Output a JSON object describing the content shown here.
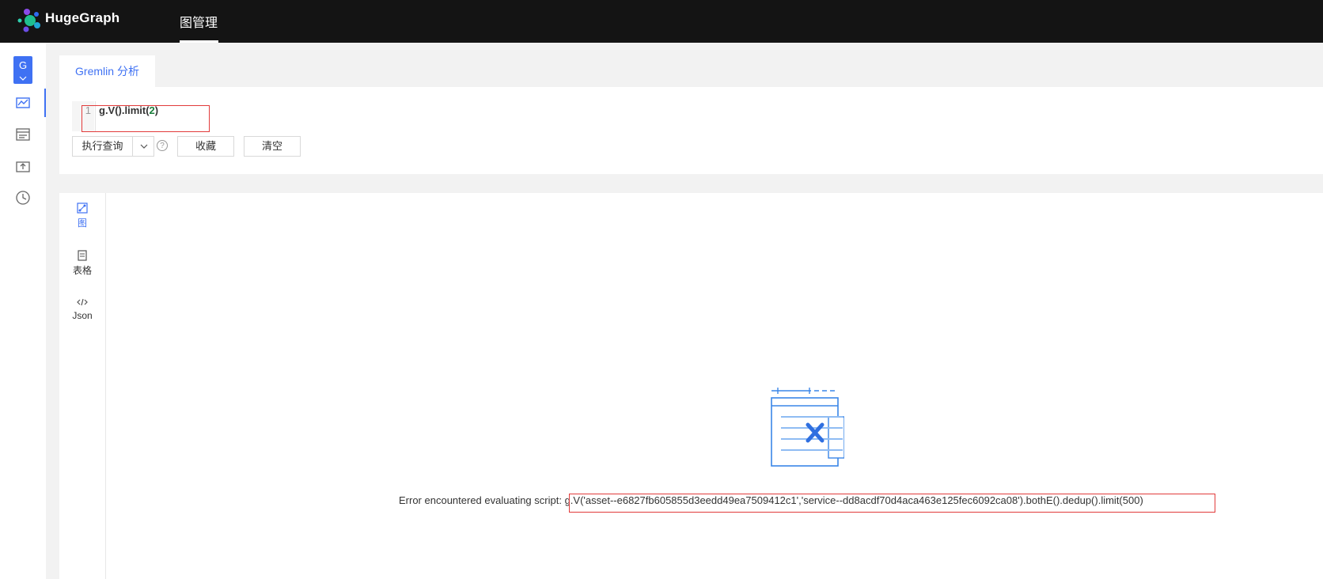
{
  "app": {
    "brand": "HugeGraph"
  },
  "topnav": {
    "active_tab": "图管理"
  },
  "sidebar": {
    "graph_badge": "G",
    "items": [
      {
        "icon": "graph-analysis-icon",
        "active": true
      },
      {
        "icon": "data-management-icon",
        "active": false
      },
      {
        "icon": "data-import-icon",
        "active": false
      },
      {
        "icon": "history-clock-icon",
        "active": false
      }
    ]
  },
  "query": {
    "tab_label": "Gremlin 分析",
    "line_number": "1",
    "code_prefix": "g.V().limit(",
    "code_number": "2",
    "code_suffix": ")",
    "run_button": "执行查询",
    "help_glyph": "?",
    "favorite_button": "收藏",
    "clear_button": "清空"
  },
  "result": {
    "views": [
      {
        "label": "图",
        "icon": "graph-view-icon",
        "active": true
      },
      {
        "label": "表格",
        "icon": "table-view-icon",
        "active": false
      },
      {
        "label": "Json",
        "icon": "code-view-icon",
        "active": false
      }
    ],
    "error_prefix": "Error encountered evaluating script: ",
    "error_script": "g.V('asset--e6827fb605855d3eedd49ea7509412c1','service--dd8acdf70d4aca463e125fec6092ca08').bothE().dedup().limit(500)"
  },
  "colors": {
    "accent": "#3f71f3",
    "topbar": "#141414",
    "highlight_box": "#e23b3b"
  }
}
